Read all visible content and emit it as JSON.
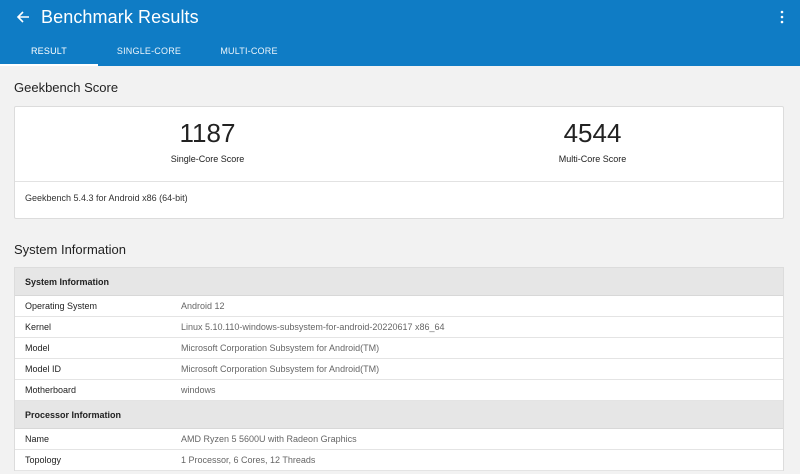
{
  "appbar": {
    "title": "Benchmark Results",
    "back_icon": "arrow-left-icon",
    "menu_icon": "more-vert-icon",
    "color": "#0f7cc5"
  },
  "tabs": [
    {
      "label": "RESULT",
      "active": true
    },
    {
      "label": "SINGLE-CORE",
      "active": false
    },
    {
      "label": "MULTI-CORE",
      "active": false
    }
  ],
  "score_section": {
    "title": "Geekbench Score",
    "single_core": {
      "value": "1187",
      "label": "Single-Core Score"
    },
    "multi_core": {
      "value": "4544",
      "label": "Multi-Core Score"
    },
    "version": "Geekbench 5.4.3 for Android x86 (64-bit)"
  },
  "system_section": {
    "title": "System Information",
    "groups": [
      {
        "header": "System Information",
        "rows": [
          {
            "key": "Operating System",
            "value": "Android 12"
          },
          {
            "key": "Kernel",
            "value": "Linux 5.10.110-windows-subsystem-for-android-20220617 x86_64"
          },
          {
            "key": "Model",
            "value": "Microsoft Corporation Subsystem for Android(TM)"
          },
          {
            "key": "Model ID",
            "value": "Microsoft Corporation Subsystem for Android(TM)"
          },
          {
            "key": "Motherboard",
            "value": "windows"
          }
        ]
      },
      {
        "header": "Processor Information",
        "rows": [
          {
            "key": "Name",
            "value": "AMD Ryzen 5 5600U with Radeon Graphics"
          },
          {
            "key": "Topology",
            "value": "1 Processor, 6 Cores, 12 Threads"
          }
        ]
      }
    ]
  }
}
